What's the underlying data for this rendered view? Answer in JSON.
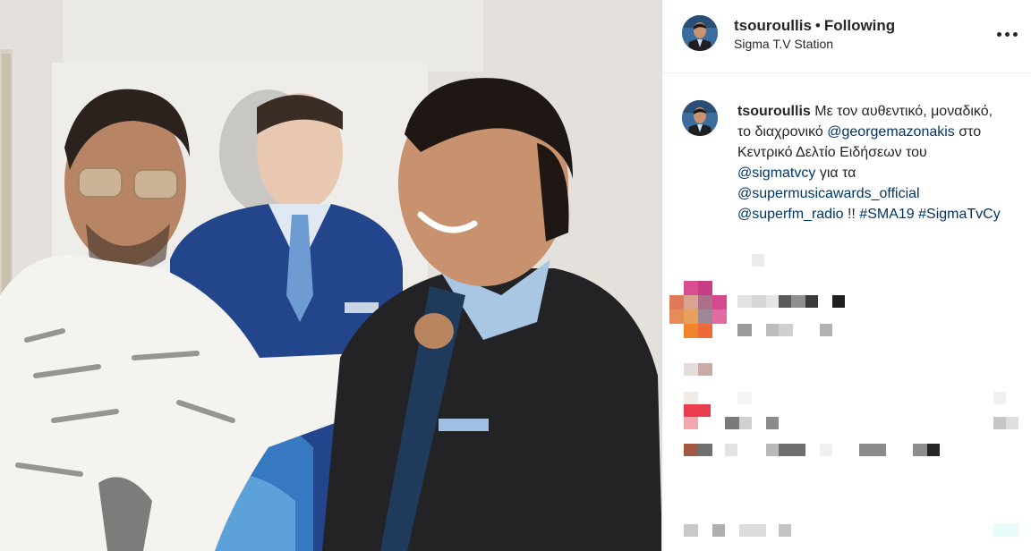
{
  "post": {
    "username": "tsouroullis",
    "separator": "•",
    "follow_state": "Following",
    "location": "Sigma T.V Station",
    "more_options_icon": "more-horizontal-icon"
  },
  "caption": {
    "username": "tsouroullis",
    "parts": [
      {
        "type": "text",
        "value": "Με τον αυθεντικό, μοναδικό, το διαχρονικό "
      },
      {
        "type": "mention",
        "value": "@georgemazonakis"
      },
      {
        "type": "text",
        "value": " στο Κεντρικό Δελτίο Ειδήσεων του "
      },
      {
        "type": "mention",
        "value": "@sigmatvcy"
      },
      {
        "type": "text",
        "value": " για τα "
      },
      {
        "type": "mention",
        "value": "@supermusicawards_official"
      },
      {
        "type": "text",
        "value": " "
      },
      {
        "type": "mention",
        "value": "@superfm_radio"
      },
      {
        "type": "text",
        "value": " !! "
      },
      {
        "type": "hashtag",
        "value": "#SMA19"
      },
      {
        "type": "text",
        "value": " "
      },
      {
        "type": "hashtag",
        "value": "#SigmaTvCy"
      }
    ]
  },
  "colors": {
    "link": "#003569",
    "text": "#262626",
    "divider": "#efefef"
  }
}
